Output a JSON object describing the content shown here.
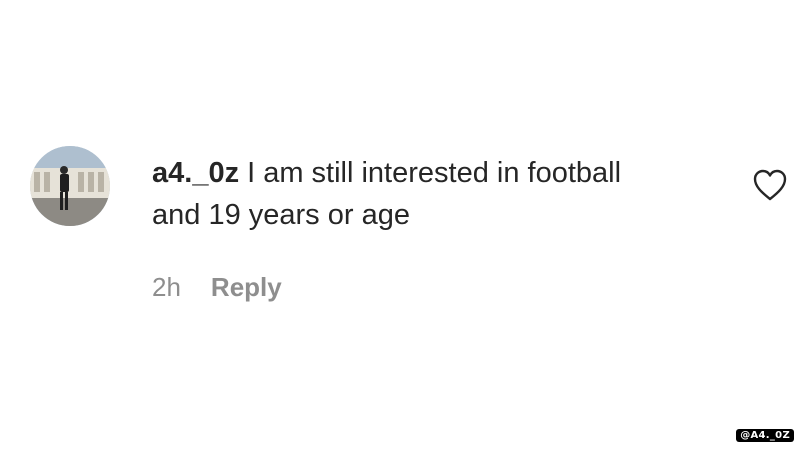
{
  "comment": {
    "username": "a4._0z",
    "text": "I am still interested in football and 19 years or age",
    "timestamp": "2h",
    "reply_label": "Reply",
    "like_icon": "heart-outline-icon",
    "avatar": "profile-photo"
  },
  "watermark": "@A4._0Z",
  "colors": {
    "text": "#262626",
    "secondary": "#8e8e8e",
    "background": "#ffffff"
  }
}
